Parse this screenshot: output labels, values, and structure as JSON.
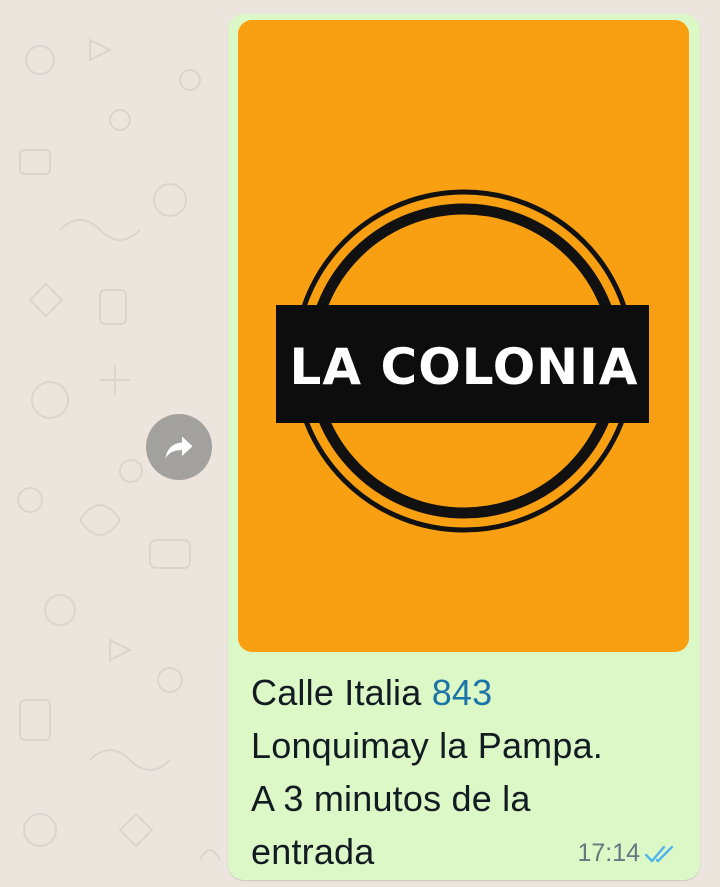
{
  "message": {
    "image": {
      "logo_text": "LA COLONIA",
      "background_color": "#f8a012"
    },
    "caption": {
      "line1_text": "Calle Italia ",
      "line1_number": "843",
      "line2": "Lonquimay la Pampa.",
      "line3": "A 3 minutos de la",
      "line4": "entrada"
    },
    "time": "17:14",
    "status_icon": "double-check-read-icon"
  },
  "actions": {
    "forward_icon": "forward-icon"
  },
  "colors": {
    "bubble": "#dcf8c6",
    "wallpaper": "#ece5dd",
    "link": "#1b74a8",
    "read_ticks": "#4fb6ec"
  }
}
